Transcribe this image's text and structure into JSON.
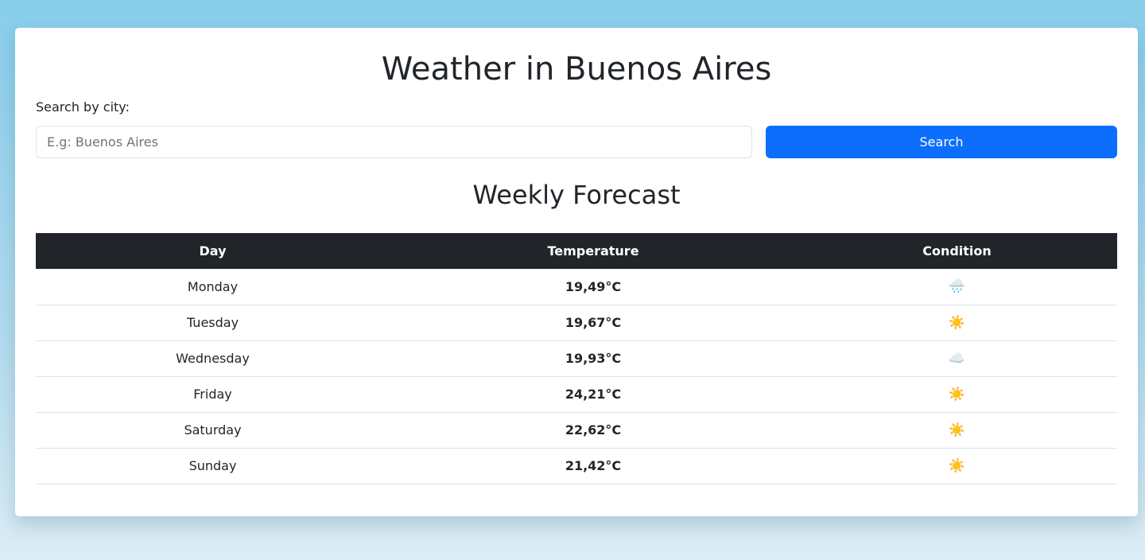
{
  "header": {
    "title": "Weather in Buenos Aires"
  },
  "search": {
    "label": "Search by city:",
    "placeholder": "E.g: Buenos Aires",
    "value": "",
    "button_label": "Search"
  },
  "forecast": {
    "title": "Weekly Forecast",
    "columns": [
      "Day",
      "Temperature",
      "Condition"
    ],
    "rows": [
      {
        "day": "Monday",
        "temperature": "19,49°C",
        "condition_icon": "🌧️",
        "condition_name": "rain-icon"
      },
      {
        "day": "Tuesday",
        "temperature": "19,67°C",
        "condition_icon": "☀️",
        "condition_name": "sun-icon"
      },
      {
        "day": "Wednesday",
        "temperature": "19,93°C",
        "condition_icon": "☁️",
        "condition_name": "cloud-icon"
      },
      {
        "day": "Friday",
        "temperature": "24,21°C",
        "condition_icon": "☀️",
        "condition_name": "sun-icon"
      },
      {
        "day": "Saturday",
        "temperature": "22,62°C",
        "condition_icon": "☀️",
        "condition_name": "sun-icon"
      },
      {
        "day": "Sunday",
        "temperature": "21,42°C",
        "condition_icon": "☀️",
        "condition_name": "sun-icon"
      }
    ]
  },
  "colors": {
    "accent": "#0d6efd",
    "table_header": "#212529"
  }
}
